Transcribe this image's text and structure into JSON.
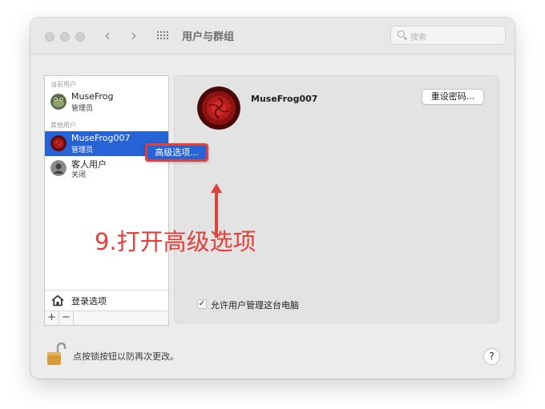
{
  "window": {
    "title": "用户与群组",
    "search_placeholder": "搜索"
  },
  "sidebar": {
    "current_users_label": "当前用户",
    "other_users_label": "其他用户",
    "users": [
      {
        "name": "MuseFrog",
        "role": "管理员",
        "selected": false,
        "avatar": "frog-avatar-icon"
      },
      {
        "name": "MuseFrog007",
        "role": "管理员",
        "selected": true,
        "avatar": "rose-avatar-icon"
      },
      {
        "name": "客人用户",
        "role": "关闭",
        "selected": false,
        "avatar": "guest-avatar-icon"
      }
    ],
    "login_options_label": "登录选项",
    "add_label": "+",
    "remove_label": "−"
  },
  "detail": {
    "user_name": "MuseFrog007",
    "reset_password_label": "重设密码...",
    "allow_admin_label": "允许用户管理这台电脑",
    "allow_admin_checked": true,
    "checkmark": "✓"
  },
  "context_menu": {
    "advanced_options_label": "高级选项..."
  },
  "annotation": {
    "text": "9.打开高级选项"
  },
  "footer": {
    "lock_text": "点按锁按钮以防再次更改。",
    "help_label": "?"
  },
  "colors": {
    "accent": "#2563d6",
    "annotation_red": "#e0413b"
  }
}
